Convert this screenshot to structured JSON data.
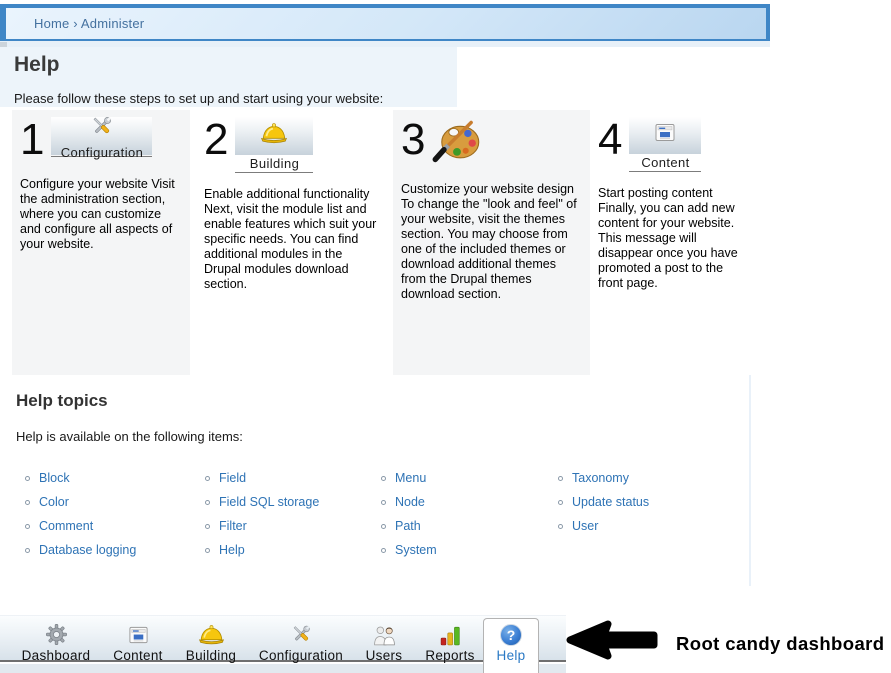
{
  "breadcrumb": {
    "text": "Home › Administer"
  },
  "page": {
    "title": "Help",
    "intro": "Please follow these steps to set up and start using your website:"
  },
  "steps": [
    {
      "number": "1",
      "icon": "configuration-tools-icon",
      "label": "Configuration",
      "description": "Configure your website Visit the administration section, where you can customize and configure all aspects of your website."
    },
    {
      "number": "2",
      "icon": "hardhat-icon",
      "label": "Building",
      "description": "Enable additional functionality Next, visit the module list and enable features which suit your specific needs. You can find additional modules in the Drupal modules download section."
    },
    {
      "number": "3",
      "icon": "palette-icon",
      "label": "",
      "description": "Customize your website design To change the \"look and feel\" of your website, visit the themes section. You may choose from one of the included themes or download additional themes from the Drupal themes download section."
    },
    {
      "number": "4",
      "icon": "content-window-icon",
      "label": "Content",
      "description": "Start posting content Finally, you can add new content for your website. This message will disappear once you have promoted a post to the front page."
    }
  ],
  "help_topics": {
    "title": "Help topics",
    "subtitle": "Help is available on the following items:",
    "columns": [
      [
        "Block",
        "Color",
        "Comment",
        "Database logging"
      ],
      [
        "Field",
        "Field SQL storage",
        "Filter",
        "Help"
      ],
      [
        "Menu",
        "Node",
        "Path",
        "System"
      ],
      [
        "Taxonomy",
        "Update status",
        "User"
      ]
    ]
  },
  "toolbar": {
    "items": [
      {
        "label": "Dashboard",
        "icon": "gear-icon",
        "active": false
      },
      {
        "label": "Content",
        "icon": "content-window-icon",
        "active": false
      },
      {
        "label": "Building",
        "icon": "hardhat-icon",
        "active": false
      },
      {
        "label": "Configuration",
        "icon": "configuration-tools-icon",
        "active": false
      },
      {
        "label": "Users",
        "icon": "users-icon",
        "active": false
      },
      {
        "label": "Reports",
        "icon": "bar-chart-icon",
        "active": false
      },
      {
        "label": "Help",
        "icon": "question-mark-icon",
        "active": true
      }
    ]
  },
  "annotation": {
    "label": "Root candy dashboard",
    "icon": "left-arrow-icon"
  },
  "colors": {
    "breadcrumb_border": "#3f86c6",
    "breadcrumb_text": "#44719f",
    "panel_blue": "#edf4fa",
    "column_gray": "#f4f5f6",
    "link_blue": "#2e73b5",
    "active_tab_blue": "#2a79c5",
    "toolbar_border": "#6f6f6f"
  }
}
